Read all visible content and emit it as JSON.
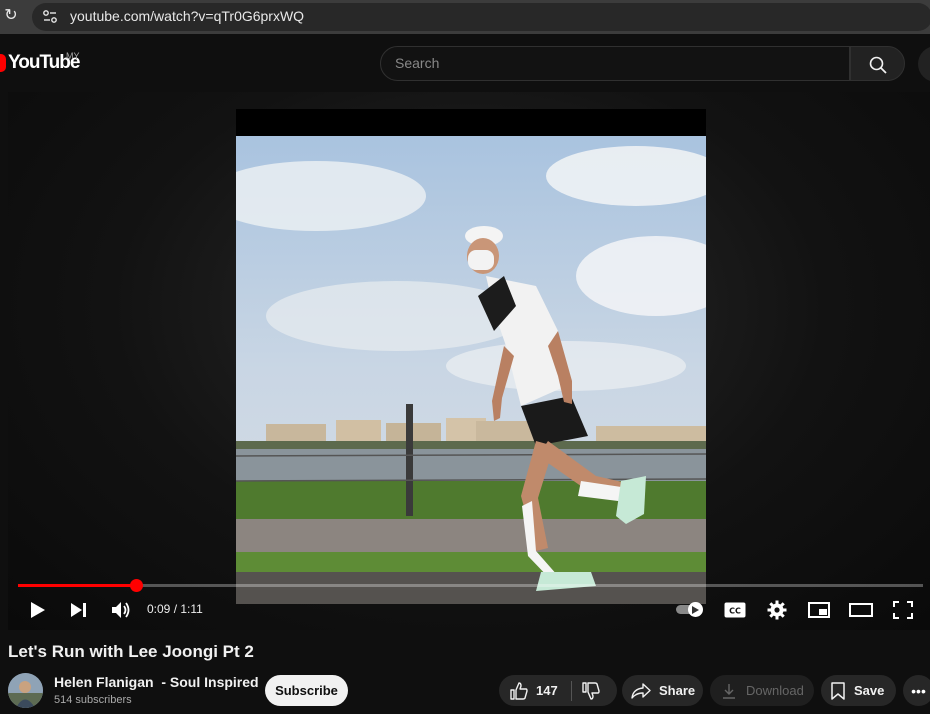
{
  "browser": {
    "url": "youtube.com/watch?v=qTr0G6prxWQ"
  },
  "masthead": {
    "logo_text": "YouTube",
    "country_code": "MY",
    "search_placeholder": "Search"
  },
  "player": {
    "current_time": "0:09",
    "separator": " / ",
    "duration": "1:11",
    "progress": 0.13,
    "autoplay_on": true
  },
  "video": {
    "title": "Let's Run with Lee Joongi Pt 2"
  },
  "channel": {
    "name": "Helen Flanigan  - Soul Inspired",
    "subscribers": "514 subscribers",
    "subscribe_label": "Subscribe"
  },
  "actions": {
    "like_count": "147",
    "share_label": "Share",
    "download_label": "Download",
    "save_label": "Save"
  },
  "icons": {
    "reload": "reload-icon",
    "site_info": "site-settings-icon",
    "search": "search-icon",
    "play": "play-icon",
    "next": "next-icon",
    "volume": "volume-icon",
    "captions": "captions-icon",
    "settings": "gear-icon",
    "miniplayer": "miniplayer-icon",
    "theater": "theater-mode-icon",
    "fullscreen": "fullscreen-icon",
    "like": "thumbs-up-icon",
    "dislike": "thumbs-down-icon",
    "share": "share-icon",
    "download": "download-icon",
    "save": "save-icon",
    "more": "more-icon"
  },
  "colors": {
    "brand_red": "#ff0000",
    "background": "#0f0f0f",
    "pill": "#272727"
  }
}
